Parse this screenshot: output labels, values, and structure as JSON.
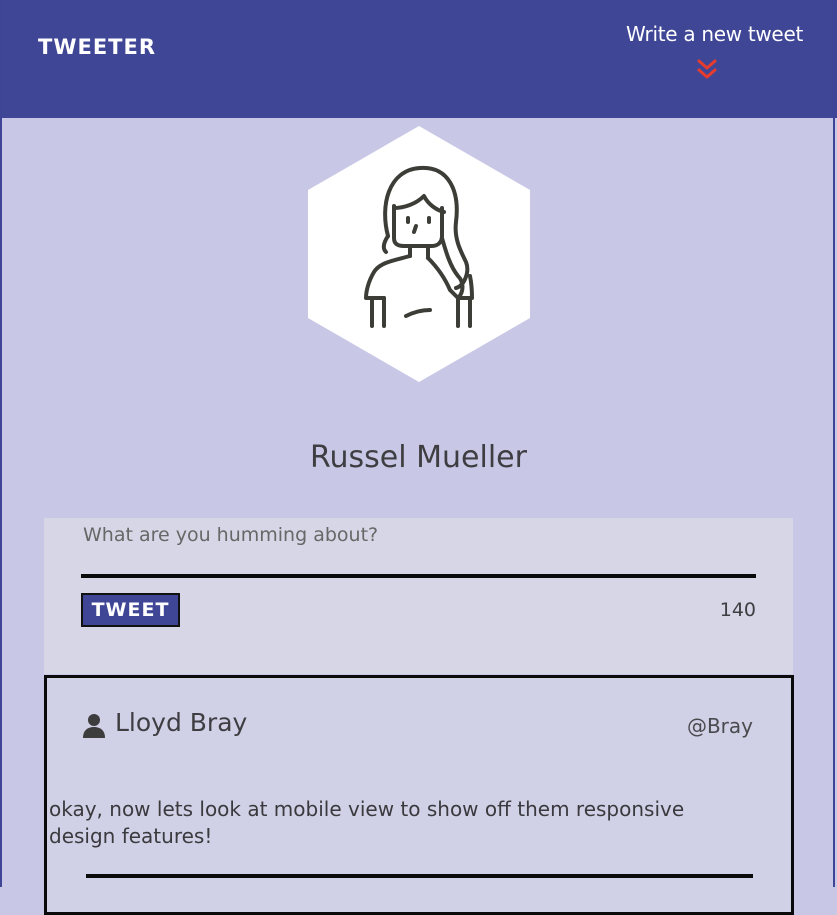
{
  "navbar": {
    "logo": "TWEETER",
    "compose_label": "Write a new tweet",
    "compose_icon": "chevron-double-down-icon",
    "background": "#3f4696",
    "accent": "#e53c2e"
  },
  "profile": {
    "avatar_icon": "user-portrait-icon",
    "name": "Russel Mueller"
  },
  "composer": {
    "placeholder": "What are you humming about?",
    "button_label": "TWEET",
    "char_count": "140"
  },
  "tweets": [
    {
      "author": "Lloyd Bray",
      "handle": "@Bray",
      "icon": "user-icon",
      "body": "okay, now lets look at mobile view to show off them responsive design features!"
    }
  ]
}
